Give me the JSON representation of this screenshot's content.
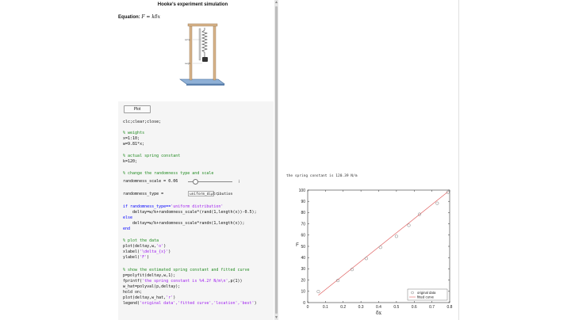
{
  "app": {
    "title": "Hooke's experiment simulation"
  },
  "equation": {
    "label": "Equation:",
    "formula": "F = kδx"
  },
  "apparatus": {
    "labels": [
      "spring",
      "weight"
    ]
  },
  "controls": {
    "plot_label": "Plot"
  },
  "code": {
    "line01": "clc;clear;close;",
    "line02": "% weights",
    "line03": "x=1:10;",
    "line04": "w=9.81*x;",
    "line05": "% actual spring constant",
    "line06": "k=120;",
    "line07": "% change the randomness type and scale",
    "line08_a": "randomness_scale = 0.06",
    "line08_b": ";",
    "line09_a": "randomness_type =",
    "line09_b": ";",
    "line10_a": "if randomness_type==",
    "line10_b": "'uniform distribution'",
    "line11": "    deltay=w/k+randomness_scale*(rand(1,length(x))-0.5);",
    "line12": "else",
    "line13": "    deltay=w/k+randomness_scale*randn(1,length(x));",
    "line14": "end",
    "line15": "% plot the data",
    "line16_a": "plot(deltay,w,",
    "line16_b": "'o'",
    "line16_c": ")",
    "line17_a": "xlabel(",
    "line17_b": "'\\delta_{x}'",
    "line17_c": ")",
    "line18_a": "ylabel(",
    "line18_b": "'F'",
    "line18_c": ")",
    "line19": "% show the estimated spring constant and fitted curve",
    "line20": "p=polyfit(deltay,w,1);",
    "line21_a": "fprintf(",
    "line21_b": "'the spring constant is %4.2f N/m\\n'",
    "line21_c": ",p(1))",
    "line22": "w_hat=polyval(p,deltay);",
    "line23": "hold on;",
    "line24_a": "plot(deltay,w_hat,",
    "line24_b": "'r'",
    "line24_c": ")",
    "line25_a": "legend(",
    "line25_b": "'original data','fitted curve','location','best'",
    "line25_c": ")"
  },
  "slider": {
    "value": 0.06
  },
  "dropdown": {
    "selected": "uniform_distribution"
  },
  "output": {
    "text": "the spring constant is 120.39 N/m"
  },
  "colors": {
    "data": "#7f7f7f",
    "fit": "#e06060",
    "comment": "#228b22",
    "string": "#a020f0"
  },
  "chart_data": {
    "type": "scatter",
    "xlabel": "δx",
    "ylabel": "F",
    "xlim": [
      0,
      0.8
    ],
    "ylim": [
      0,
      100
    ],
    "x_ticks": [
      0,
      0.1,
      0.2,
      0.3,
      0.4,
      0.5,
      0.6,
      0.7,
      0.8
    ],
    "y_ticks": [
      0,
      10,
      20,
      30,
      40,
      50,
      60,
      70,
      80,
      90,
      100
    ],
    "x_tick_labels": [
      "0",
      "0.1",
      "0.2",
      "0.3",
      "0.4",
      "0.5",
      "0.6",
      "0.7",
      "0.8"
    ],
    "y_tick_labels": [
      "0",
      "10",
      "20",
      "30",
      "40",
      "50",
      "60",
      "70",
      "80",
      "90",
      "100"
    ],
    "legend_position": "bottom-right",
    "series": [
      {
        "name": "original data",
        "style": "markers",
        "x": [
          0.06,
          0.17,
          0.25,
          0.33,
          0.41,
          0.5,
          0.57,
          0.63,
          0.73,
          0.79
        ],
        "y": [
          9.8,
          19.6,
          29.4,
          39.2,
          49.1,
          58.9,
          68.7,
          78.5,
          88.3,
          98.1
        ]
      },
      {
        "name": "fitted curve",
        "style": "line",
        "x": [
          0.06,
          0.79
        ],
        "y": [
          6.5,
          98.5
        ]
      }
    ]
  }
}
